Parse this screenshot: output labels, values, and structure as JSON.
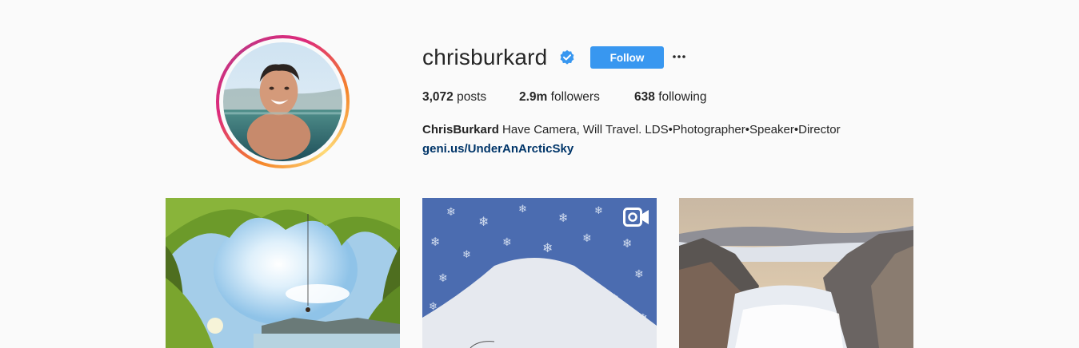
{
  "profile": {
    "username": "chrisburkard",
    "follow_label": "Follow",
    "more_icon": "more-options-icon",
    "verified_icon": "verified-badge-icon",
    "stats": {
      "posts_count": "3,072",
      "posts_label": "posts",
      "followers_count": "2.9m",
      "followers_label": "followers",
      "following_count": "638",
      "following_label": "following"
    },
    "bio_name": "ChrisBurkard",
    "bio_text": "Have Camera, Will Travel. LDS•Photographer•Speaker•Director",
    "bio_link": "geni.us/UnderAnArcticSky"
  },
  "posts": [
    {
      "type": "image"
    },
    {
      "type": "video",
      "icon": "video-icon"
    },
    {
      "type": "image"
    }
  ],
  "colors": {
    "follow_button": "#3897f0",
    "link": "#003569",
    "background": "#fafafa",
    "verified": "#3897f0"
  }
}
